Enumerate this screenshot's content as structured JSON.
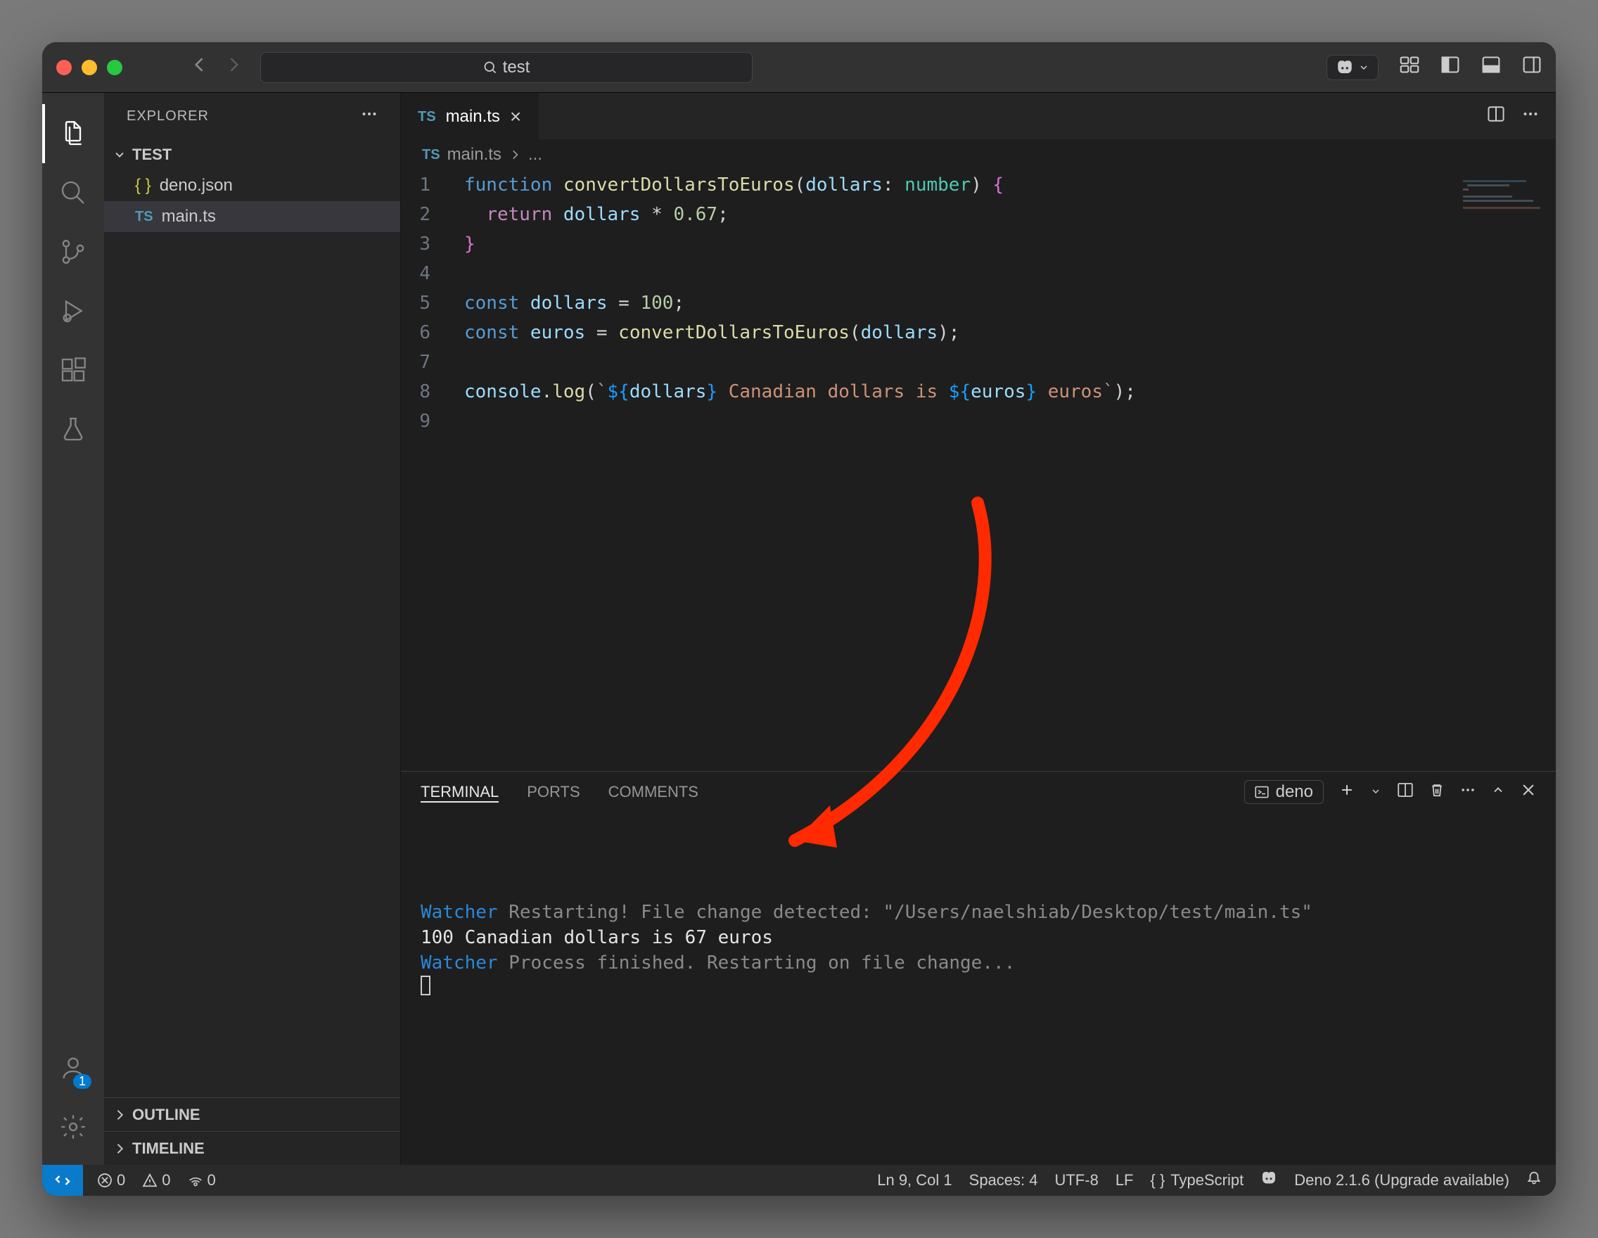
{
  "titlebar": {
    "search_text": "test"
  },
  "sidebar": {
    "title": "EXPLORER",
    "folder": "TEST",
    "files": [
      {
        "name": "deno.json",
        "icon": "json"
      },
      {
        "name": "main.ts",
        "icon": "ts",
        "active": true
      }
    ],
    "sections": [
      "OUTLINE",
      "TIMELINE"
    ]
  },
  "tabs": [
    {
      "label": "main.ts",
      "icon": "ts",
      "active": true
    }
  ],
  "breadcrumb": {
    "file": "main.ts",
    "segment": "..."
  },
  "editor": {
    "line_numbers": [
      "1",
      "2",
      "3",
      "4",
      "5",
      "6",
      "7",
      "8",
      "9"
    ],
    "code_tokens": [
      [
        [
          "k-fn",
          "function "
        ],
        [
          "k-name",
          "convertDollarsToEuros"
        ],
        [
          "k-punc",
          "("
        ],
        [
          "k-param",
          "dollars"
        ],
        [
          "k-punc",
          ": "
        ],
        [
          "k-type",
          "number"
        ],
        [
          "k-punc",
          ") "
        ],
        [
          "brace",
          "{"
        ]
      ],
      [
        [
          "k-punc",
          "  "
        ],
        [
          "k-kw",
          "return"
        ],
        [
          "k-punc",
          " "
        ],
        [
          "k-var",
          "dollars"
        ],
        [
          "k-punc",
          " * "
        ],
        [
          "k-num",
          "0.67"
        ],
        [
          "k-punc",
          ";"
        ]
      ],
      [
        [
          "brace",
          "}"
        ]
      ],
      [],
      [
        [
          "k-fn",
          "const "
        ],
        [
          "k-var",
          "dollars"
        ],
        [
          "k-punc",
          " = "
        ],
        [
          "k-num",
          "100"
        ],
        [
          "k-punc",
          ";"
        ]
      ],
      [
        [
          "k-fn",
          "const "
        ],
        [
          "k-var",
          "euros"
        ],
        [
          "k-punc",
          " = "
        ],
        [
          "k-name",
          "convertDollarsToEuros"
        ],
        [
          "k-punc",
          "("
        ],
        [
          "k-var",
          "dollars"
        ],
        [
          "k-punc",
          ");"
        ]
      ],
      [],
      [
        [
          "k-var",
          "console"
        ],
        [
          "k-punc",
          "."
        ],
        [
          "k-name",
          "log"
        ],
        [
          "k-punc",
          "("
        ],
        [
          "k-str",
          "`"
        ],
        [
          "brace2",
          "${"
        ],
        [
          "k-var",
          "dollars"
        ],
        [
          "brace2",
          "}"
        ],
        [
          "k-str",
          " Canadian dollars is "
        ],
        [
          "brace2",
          "${"
        ],
        [
          "k-var",
          "euros"
        ],
        [
          "brace2",
          "}"
        ],
        [
          "k-str",
          " euros`"
        ],
        [
          "k-punc",
          ");"
        ]
      ],
      []
    ]
  },
  "panel": {
    "tabs": [
      "TERMINAL",
      "PORTS",
      "COMMENTS"
    ],
    "active_tab": "TERMINAL",
    "terminal_profile": "deno",
    "lines": [
      [
        [
          "term-watcher",
          "Watcher"
        ],
        [
          "term-gray",
          " Restarting! File change detected: \"/Users/naelshiab/Desktop/test/main.ts\""
        ]
      ],
      [
        [
          "",
          "100 Canadian dollars is 67 euros"
        ]
      ],
      [
        [
          "term-watcher",
          "Watcher"
        ],
        [
          "term-gray",
          " Process finished. Restarting on file change..."
        ]
      ]
    ]
  },
  "statusbar": {
    "errors": "0",
    "warnings": "0",
    "ports": "0",
    "cursor": "Ln 9, Col 1",
    "indent": "Spaces: 4",
    "encoding": "UTF-8",
    "eol": "LF",
    "lang": "TypeScript",
    "deno": "Deno 2.1.6 (Upgrade available)"
  },
  "accounts_badge": "1"
}
